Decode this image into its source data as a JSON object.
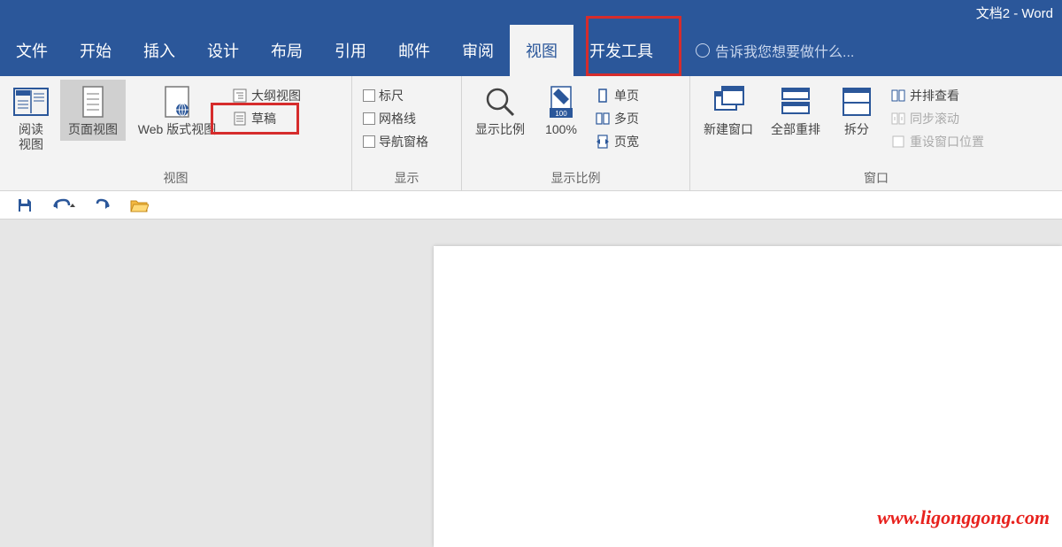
{
  "title": "文档2 - Word",
  "menu": {
    "file": "文件",
    "home": "开始",
    "insert": "插入",
    "design": "设计",
    "layout": "布局",
    "references": "引用",
    "mailings": "邮件",
    "review": "审阅",
    "view": "视图",
    "developer": "开发工具",
    "tell_me": "告诉我您想要做什么..."
  },
  "ribbon": {
    "views": {
      "read": "阅读\n视图",
      "page": "页面视图",
      "web": "Web 版式视图",
      "outline": "大纲视图",
      "draft": "草稿",
      "group": "视图"
    },
    "show": {
      "ruler": "标尺",
      "gridlines": "网格线",
      "nav_pane": "导航窗格",
      "group": "显示"
    },
    "zoom": {
      "zoom": "显示比例",
      "hundred": "100%",
      "one_page": "单页",
      "multi_page": "多页",
      "page_width": "页宽",
      "group": "显示比例"
    },
    "window": {
      "new_window": "新建窗口",
      "arrange_all": "全部重排",
      "split": "拆分",
      "side_by_side": "并排查看",
      "sync_scroll": "同步滚动",
      "reset_pos": "重设窗口位置",
      "group": "窗口"
    }
  },
  "watermark": "www.ligonggong.com"
}
